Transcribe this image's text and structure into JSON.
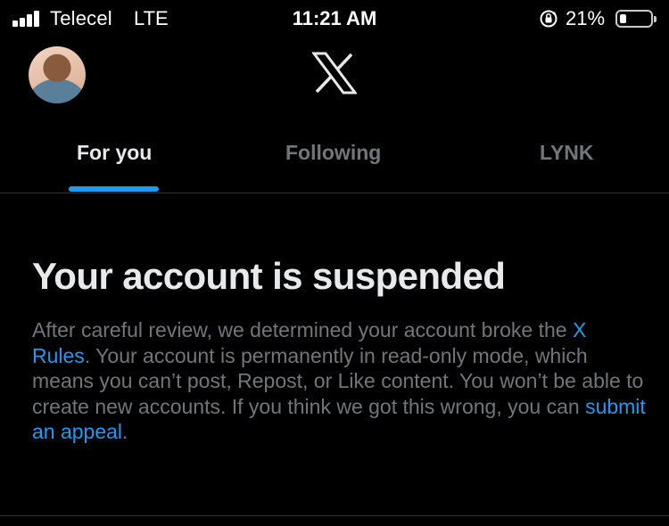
{
  "status_bar": {
    "carrier": "Telecel",
    "network": "LTE",
    "time": "11:21 AM",
    "battery_percent": "21%",
    "battery_level": 0.21,
    "icons": [
      "signal-icon",
      "rotation-lock-icon",
      "battery-icon"
    ]
  },
  "header": {
    "avatar": "profile-avatar",
    "logo": "x-logo-icon"
  },
  "tabs": [
    {
      "label": "For you",
      "active": true
    },
    {
      "label": "Following",
      "active": false
    },
    {
      "label": "LYNK",
      "active": false
    }
  ],
  "notice": {
    "title": "Your account is suspended",
    "body_1": "After careful review, we determined your account broke the ",
    "rules_link": "X Rules",
    "body_2": ". Your account is permanently in read-only mode, which means you can’t post, Repost, or Like content. You won’t be able to create new accounts. If you think we got this wrong, you can ",
    "appeal_link": "submit an appeal",
    "body_3": "."
  },
  "colors": {
    "background": "#000000",
    "accent": "#1d9bf0",
    "primary_text": "#e7e9ea",
    "secondary_text": "#71767b",
    "divider": "#2f3336"
  }
}
